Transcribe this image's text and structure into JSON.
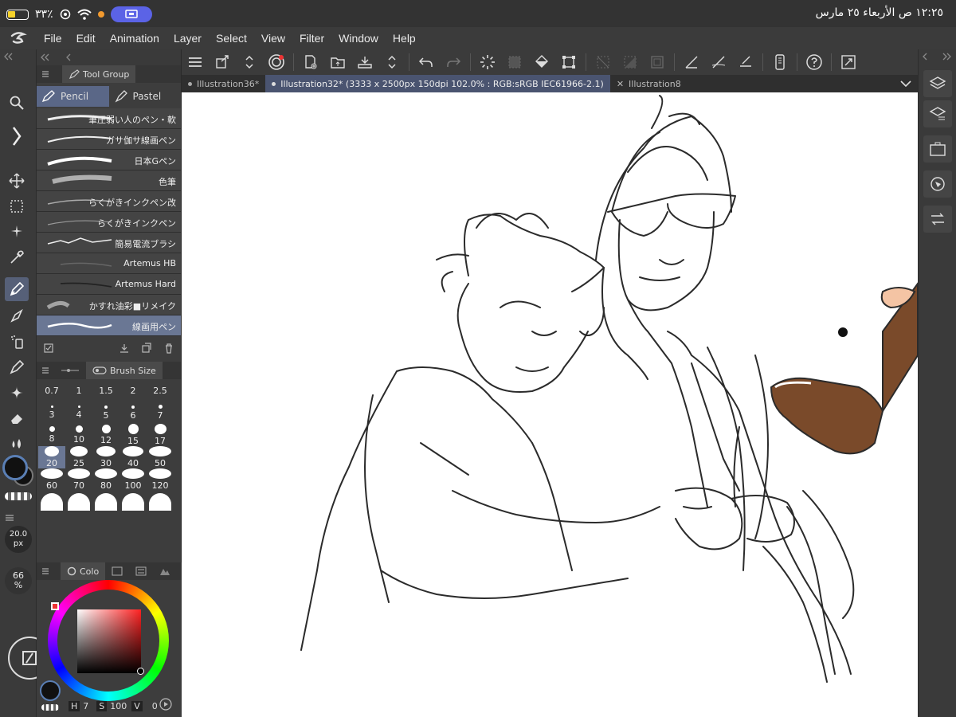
{
  "status_bar": {
    "battery": "٣٣٪",
    "datetime": "١٢:٢٥ ص   الأربعاء ٢٥ مارس"
  },
  "menu": [
    "File",
    "Edit",
    "Animation",
    "Layer",
    "Select",
    "View",
    "Filter",
    "Window",
    "Help"
  ],
  "sub_tool": {
    "header": "Tool Group",
    "tabs": [
      "Pencil",
      "Pastel"
    ],
    "brushes": [
      "筆圧弱い人のペン・軟",
      "ガサ伽サ線画ペン",
      "日本Gペン",
      "色筆",
      "らくがきインクペン改",
      "らくがきインクペン",
      "簡易電流ブラシ",
      "Artemus HB",
      "Artemus Hard",
      "かすれ油彩■リメイク",
      "線画用ペン"
    ]
  },
  "brush_size": {
    "header": "Brush Size",
    "sizes": [
      "0.7",
      "1",
      "1.5",
      "2",
      "2.5",
      "3",
      "4",
      "5",
      "6",
      "7",
      "8",
      "10",
      "12",
      "15",
      "17",
      "20",
      "25",
      "30",
      "40",
      "50",
      "60",
      "70",
      "80",
      "100",
      "120"
    ]
  },
  "tool_readouts": {
    "size_value": "20.0",
    "size_unit": "px",
    "opacity_value": "66",
    "opacity_unit": "%"
  },
  "color_panel": {
    "tab": "Colo",
    "h_label": "H",
    "h_value": "7",
    "s_label": "S",
    "s_value": "100",
    "v_label": "V",
    "v_value": "0"
  },
  "doc_tabs": [
    {
      "label": "Illustration36*"
    },
    {
      "label": "Illustration32* (3333 x 2500px 150dpi 102.0% : RGB:sRGB IEC61966-2.1)"
    },
    {
      "label": "Illustration8"
    }
  ],
  "colors": {
    "ui_bg": "#3b3b3b",
    "accent": "#5a6787",
    "canvas": "#ffffff"
  }
}
